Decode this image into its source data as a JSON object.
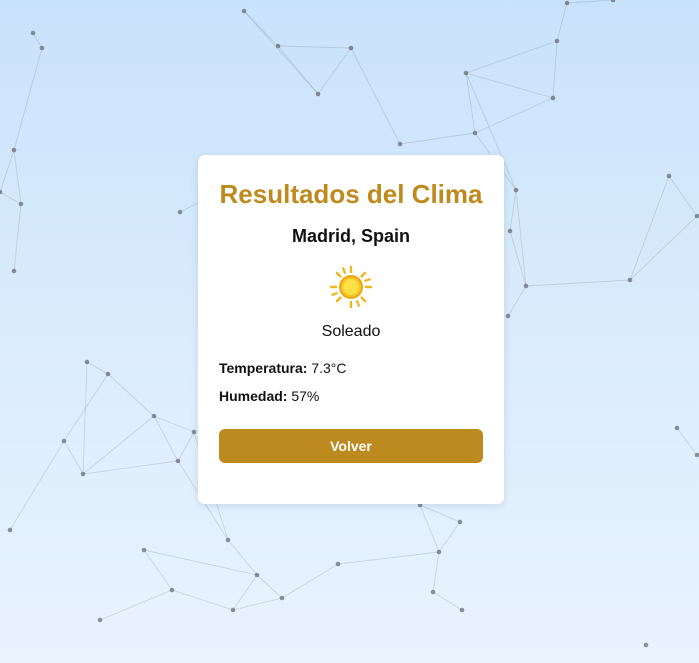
{
  "card": {
    "title": "Resultados del Clima",
    "location": "Madrid, Spain",
    "weather_icon": "sun-icon",
    "condition": "Soleado",
    "temperature_label": "Temperatura:",
    "temperature_value": "7.3°C",
    "humidity_label": "Humedad:",
    "humidity_value": "57%",
    "back_button_label": "Volver"
  },
  "colors": {
    "accent": "#bf8a1d",
    "button": "#bc8a1f",
    "sun": "#f6c521",
    "background_top": "#c9e2fb",
    "background_bottom": "#e9f3fe"
  }
}
